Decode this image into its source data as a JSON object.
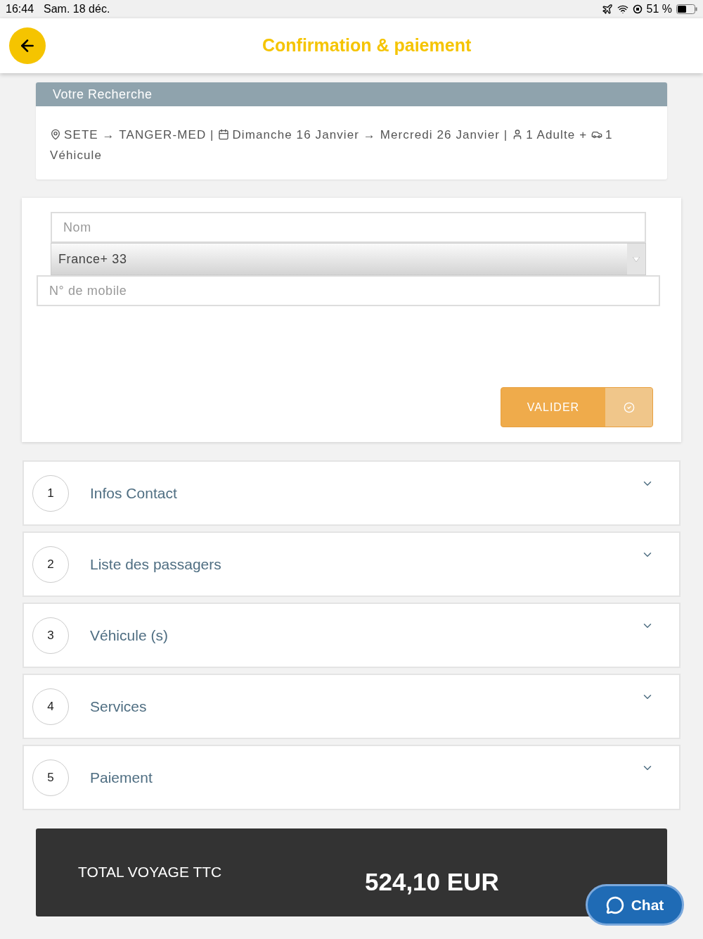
{
  "status_bar": {
    "time": "16:44",
    "date": "Sam. 18 déc.",
    "battery": "51 %"
  },
  "header": {
    "title": "Confirmation & paiement"
  },
  "search_summary": {
    "title": "Votre Recherche",
    "segments": [
      {
        "kind": "pin",
        "text": "SETE → TANGER-MED |"
      },
      {
        "kind": "calendar",
        "text": "Dimanche 16 Janvier → Mercredi 26 Janvier |"
      },
      {
        "kind": "person",
        "text": "1 Adulte +"
      },
      {
        "kind": "car",
        "text": "1"
      },
      {
        "kind": "text",
        "text": "Véhicule"
      }
    ]
  },
  "form": {
    "name": {
      "placeholder": "Nom"
    },
    "country": {
      "value": "France+ 33"
    },
    "mobile": {
      "placeholder": "N° de mobile"
    },
    "submit": "VALIDER"
  },
  "steps": [
    {
      "number": "1",
      "title": "Infos Contact",
      "expanded": false
    },
    {
      "number": "2",
      "title": "Liste des passagers",
      "expanded": false
    },
    {
      "number": "3",
      "title": "Véhicule (s)",
      "expanded": false
    },
    {
      "number": "4",
      "title": "Services",
      "expanded": false
    },
    {
      "number": "5",
      "title": "Paiement",
      "expanded": false
    }
  ],
  "total": {
    "label": "TOTAL VOYAGE TTC",
    "amount": "524,10 EUR"
  },
  "chat": {
    "label": "Chat"
  }
}
